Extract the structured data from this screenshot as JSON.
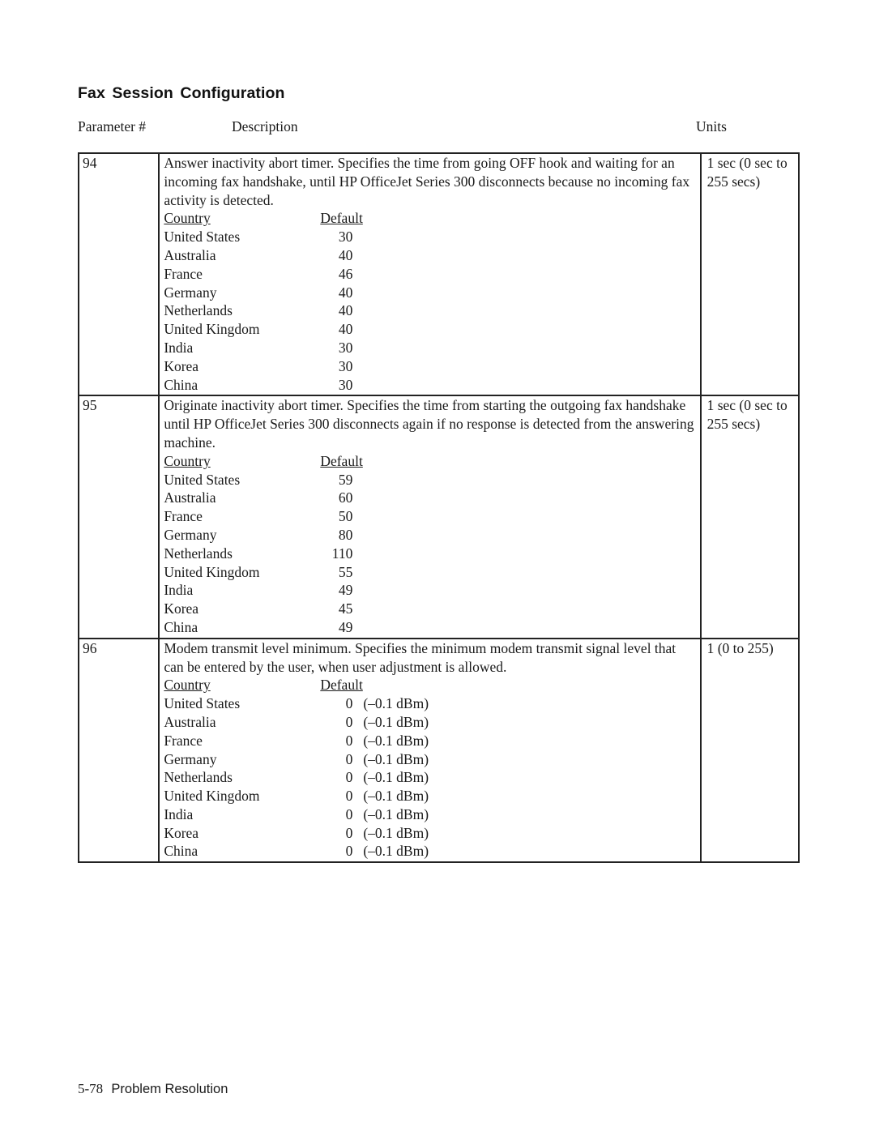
{
  "title": "Fax  Session Configuration",
  "columns": {
    "param": "Parameter #",
    "description": "Description",
    "units": "Units"
  },
  "subheaders": {
    "country": "Country",
    "default": "Default"
  },
  "rows": [
    {
      "param": "94",
      "description": "Answer inactivity abort timer. Specifies the time from going OFF hook and waiting for an incoming fax handshake, until HP OfficeJet Series 300 disconnects because no incoming fax activity is detected.",
      "units": "1 sec (0 sec to 255 secs)",
      "defaults": [
        {
          "country": "United States",
          "value": "30",
          "unit": ""
        },
        {
          "country": "Australia",
          "value": "40",
          "unit": ""
        },
        {
          "country": "France",
          "value": "46",
          "unit": ""
        },
        {
          "country": "Germany",
          "value": "40",
          "unit": ""
        },
        {
          "country": "Netherlands",
          "value": "40",
          "unit": ""
        },
        {
          "country": "United Kingdom",
          "value": "40",
          "unit": ""
        },
        {
          "country": "India",
          "value": "30",
          "unit": ""
        },
        {
          "country": "Korea",
          "value": "30",
          "unit": ""
        },
        {
          "country": "China",
          "value": "30",
          "unit": ""
        }
      ]
    },
    {
      "param": "95",
      "description": "Originate inactivity abort timer. Specifies the time from starting the  outgoing fax handshake until HP OfficeJet Series 300 disconnects again if no response is detected from the answering machine.",
      "units": "1 sec (0 sec to 255 secs)",
      "defaults": [
        {
          "country": "United States",
          "value": "59",
          "unit": ""
        },
        {
          "country": "Australia",
          "value": "60",
          "unit": ""
        },
        {
          "country": "France",
          "value": "50",
          "unit": ""
        },
        {
          "country": "Germany",
          "value": "80",
          "unit": ""
        },
        {
          "country": "Netherlands",
          "value": "110",
          "unit": ""
        },
        {
          "country": "United Kingdom",
          "value": "55",
          "unit": ""
        },
        {
          "country": "India",
          "value": "49",
          "unit": ""
        },
        {
          "country": "Korea",
          "value": "45",
          "unit": ""
        },
        {
          "country": "China",
          "value": "49",
          "unit": ""
        }
      ]
    },
    {
      "param": "96",
      "description": "Modem transmit level minimum. Specifies the minimum modem transmit signal level that can be entered by the user, when user adjustment is allowed.",
      "units": "1 (0 to 255)",
      "defaults": [
        {
          "country": "United States",
          "value": "0",
          "unit": "(–0.1 dBm)"
        },
        {
          "country": "Australia",
          "value": "0",
          "unit": "(–0.1 dBm)"
        },
        {
          "country": "France",
          "value": "0",
          "unit": "(–0.1 dBm)"
        },
        {
          "country": "Germany",
          "value": "0",
          "unit": "(–0.1 dBm)"
        },
        {
          "country": "Netherlands",
          "value": "0",
          "unit": "(–0.1 dBm)"
        },
        {
          "country": "United Kingdom",
          "value": "0",
          "unit": "(–0.1 dBm)"
        },
        {
          "country": "India",
          "value": "0",
          "unit": "(–0.1 dBm)"
        },
        {
          "country": "Korea",
          "value": "0",
          "unit": "(–0.1 dBm)"
        },
        {
          "country": "China",
          "value": "0",
          "unit": "(–0.1 dBm)"
        }
      ]
    }
  ],
  "footer": {
    "page": "5-78",
    "section": "Problem Resolution"
  }
}
